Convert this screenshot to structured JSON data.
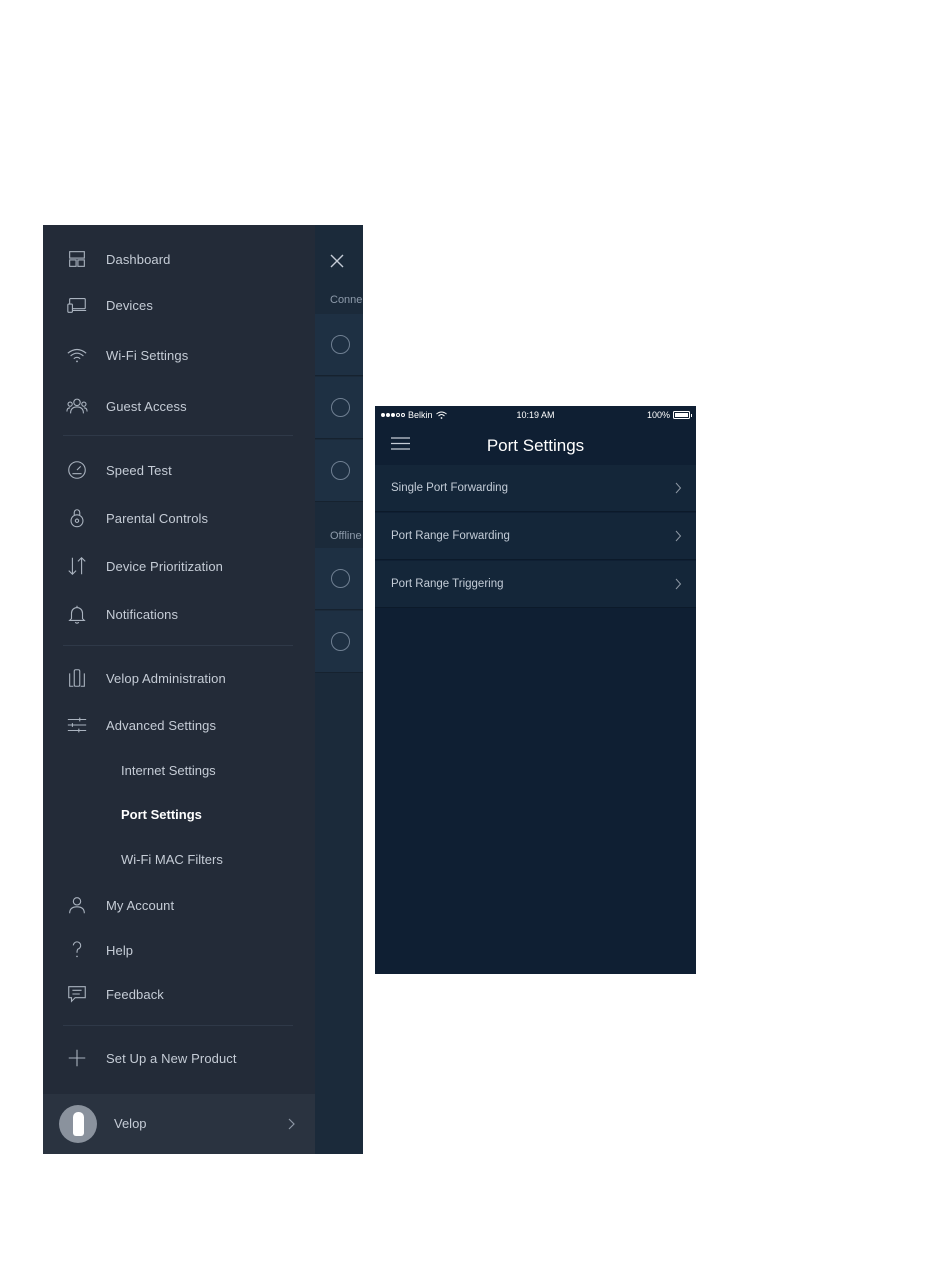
{
  "menu": {
    "items": [
      {
        "label": "Dashboard",
        "icon": "dashboard-icon"
      },
      {
        "label": "Devices",
        "icon": "devices-icon"
      },
      {
        "label": "Wi-Fi Settings",
        "icon": "wifi-icon"
      },
      {
        "label": "Guest Access",
        "icon": "guest-icon"
      },
      {
        "label": "Speed Test",
        "icon": "speedometer-icon"
      },
      {
        "label": "Parental Controls",
        "icon": "lock-icon"
      },
      {
        "label": "Device Prioritization",
        "icon": "priority-arrows-icon"
      },
      {
        "label": "Notifications",
        "icon": "bell-icon"
      },
      {
        "label": "Velop Administration",
        "icon": "velop-node-icon"
      },
      {
        "label": "Advanced Settings",
        "icon": "sliders-icon"
      },
      {
        "label": "My Account",
        "icon": "user-icon"
      },
      {
        "label": "Help",
        "icon": "question-icon"
      },
      {
        "label": "Feedback",
        "icon": "chat-icon"
      },
      {
        "label": "Set Up a New Product",
        "icon": "plus-icon"
      }
    ],
    "submenu": [
      {
        "label": "Internet Settings",
        "active": false
      },
      {
        "label": "Port Settings",
        "active": true
      },
      {
        "label": "Wi-Fi MAC Filters",
        "active": false
      }
    ],
    "footer": {
      "label": "Velop",
      "icon": "velop-avatar-icon"
    }
  },
  "peek": {
    "connected_label": "Conne",
    "offline_label": "Offline"
  },
  "port_settings": {
    "status": {
      "carrier": "Belkin",
      "time": "10:19 AM",
      "battery": "100%"
    },
    "title": "Port Settings",
    "rows": [
      {
        "label": "Single Port Forwarding"
      },
      {
        "label": "Port Range Forwarding"
      },
      {
        "label": "Port Range Triggering"
      }
    ]
  },
  "colors": {
    "menu_bg": "#232b38",
    "screen_bg": "#0f1f33",
    "row_bg": "#142639",
    "text": "#c5ccd6",
    "active_text": "#ffffff"
  }
}
